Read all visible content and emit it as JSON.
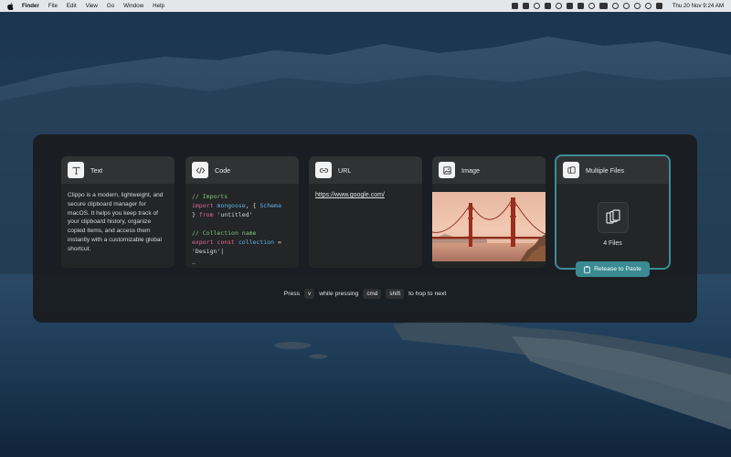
{
  "menubar": {
    "app": "Finder",
    "items": [
      "File",
      "Edit",
      "View",
      "Go",
      "Window",
      "Help"
    ],
    "clock": "Thu 20 Nov  9:24 AM"
  },
  "cards": {
    "text": {
      "title": "Text",
      "content": "Clippo is a modern, lightweight, and secure clipboard manager for macOS. It helps you keep track of your clipboard history, organize copied items, and access them instantly with a customizable global shortcut."
    },
    "code": {
      "title": "Code",
      "lines": [
        [
          {
            "t": "// Imports",
            "c": "comment"
          }
        ],
        [
          {
            "t": "import ",
            "c": "kw"
          },
          {
            "t": "mongoose",
            "c": "id"
          },
          {
            "t": ", { ",
            "c": "str"
          },
          {
            "t": "Schema",
            "c": "id"
          }
        ],
        [
          {
            "t": "} ",
            "c": "str"
          },
          {
            "t": "from ",
            "c": "kw"
          },
          {
            "t": "'untitled'",
            "c": "str"
          }
        ],
        [
          {
            "t": "",
            "c": "str"
          }
        ],
        [
          {
            "t": "// Collection name",
            "c": "comment"
          }
        ],
        [
          {
            "t": "export ",
            "c": "kw"
          },
          {
            "t": "const ",
            "c": "kw"
          },
          {
            "t": "collection",
            "c": "id"
          },
          {
            "t": " =",
            "c": "str"
          }
        ],
        [
          {
            "t": "'Design'|",
            "c": "str"
          }
        ],
        [
          {
            "t": "_",
            "c": "str"
          }
        ]
      ]
    },
    "url": {
      "title": "URL",
      "link": "https://www.google.com/"
    },
    "image": {
      "title": "Image"
    },
    "files": {
      "title": "Multiple Files",
      "count_label": "4 Files",
      "release_label": "Release to Paste"
    }
  },
  "hint": {
    "press": "Press",
    "key_v": "v",
    "while": "while pressing",
    "key_cmd": "cmd",
    "key_shift": "shift",
    "tail": "to hop to next"
  },
  "colors": {
    "accent": "#3a8a92",
    "selected_border": "#3e8c96",
    "panel": "#1a1c1e"
  },
  "icons": {
    "text": "text-format-icon",
    "code": "code-brackets-icon",
    "url": "link-icon",
    "image": "image-icon",
    "files": "multiple-files-icon"
  }
}
